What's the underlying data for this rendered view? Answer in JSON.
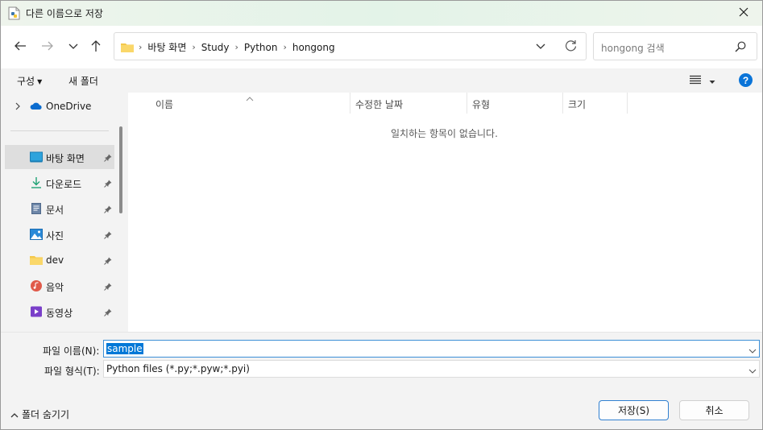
{
  "window": {
    "title": "다른 이름으로 저장"
  },
  "address": {
    "crumbs": [
      "바탕 화면",
      "Study",
      "Python",
      "hongong"
    ]
  },
  "search": {
    "placeholder": "hongong 검색"
  },
  "toolbar": {
    "organize": "구성",
    "new_folder": "새 폴더"
  },
  "nav": {
    "onedrive": "OneDrive",
    "items": [
      {
        "label": "바탕 화면",
        "icon": "desktop-icon"
      },
      {
        "label": "다운로드",
        "icon": "download-icon"
      },
      {
        "label": "문서",
        "icon": "document-icon"
      },
      {
        "label": "사진",
        "icon": "pictures-icon"
      },
      {
        "label": "dev",
        "icon": "folder-icon"
      },
      {
        "label": "음악",
        "icon": "music-icon"
      },
      {
        "label": "동영상",
        "icon": "video-icon"
      }
    ]
  },
  "columns": {
    "name": "이름",
    "modified": "수정한 날짜",
    "type": "유형",
    "size": "크기"
  },
  "content": {
    "empty_message": "일치하는 항목이 없습니다."
  },
  "fields": {
    "filename_label": "파일 이름(N):",
    "filename_value": "sample",
    "filetype_label": "파일 형식(T):",
    "filetype_value": "Python files (*.py;*.pyw;*.pyi)"
  },
  "footer": {
    "hide_folders": "폴더 숨기기",
    "save": "저장(S)",
    "cancel": "취소"
  },
  "colors": {
    "accent": "#0078d7",
    "help": "#0a74d8"
  }
}
